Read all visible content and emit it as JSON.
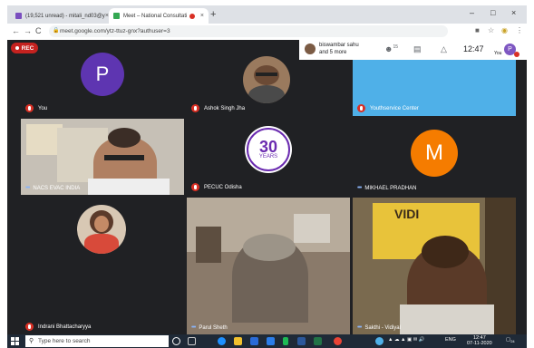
{
  "browser": {
    "tabs": [
      {
        "title": "(19,521 unread) - mitali_nd03@y",
        "close": "×"
      },
      {
        "title": "Meet – National Consultati",
        "close": "×"
      }
    ],
    "new_tab": "+",
    "window_controls": {
      "minimize": "–",
      "maximize": "□",
      "close": "×"
    },
    "nav": {
      "back": "←",
      "forward": "→",
      "reload": "C"
    },
    "url": "meet.google.com/ytz-ttuz-gnx?authuser=3"
  },
  "meet": {
    "rec_label": "REC",
    "participants_text_line1": "biswambar sahu",
    "participants_text_line2": "and 5 more",
    "people_count": "15",
    "time": "12:47",
    "you_label": "You",
    "self_initial": "P",
    "tiles": [
      {
        "name": "You",
        "initial": "P",
        "color": "#5e35b1"
      },
      {
        "name": "Ashok Singh Jha"
      },
      {
        "name": "Youthservice Center",
        "color": "#4fb0e8"
      },
      {
        "name": "NACS EVAC INDIA"
      },
      {
        "name": "PECUC Odisha",
        "logo_number": "30",
        "logo_word": "YEARS"
      },
      {
        "name": "MIKHAEL PRADHAN",
        "initial": "M",
        "color": "#f57c00"
      },
      {
        "name": "Indrani Bhattacharyya"
      },
      {
        "name": "Parul Sheth"
      },
      {
        "name": "Sakthi - Vidiyal",
        "banner_text": "VIDI"
      }
    ]
  },
  "taskbar": {
    "search_placeholder": "Type here to search",
    "lang": "ENG",
    "clock_time": "12:47",
    "clock_date": "07-11-2020",
    "notification_count": "24"
  },
  "colors": {
    "meet_bg": "#202124",
    "tile_bg": "#3c4043",
    "rec_red": "#c5221f",
    "taskbar": "#1f2a37"
  }
}
